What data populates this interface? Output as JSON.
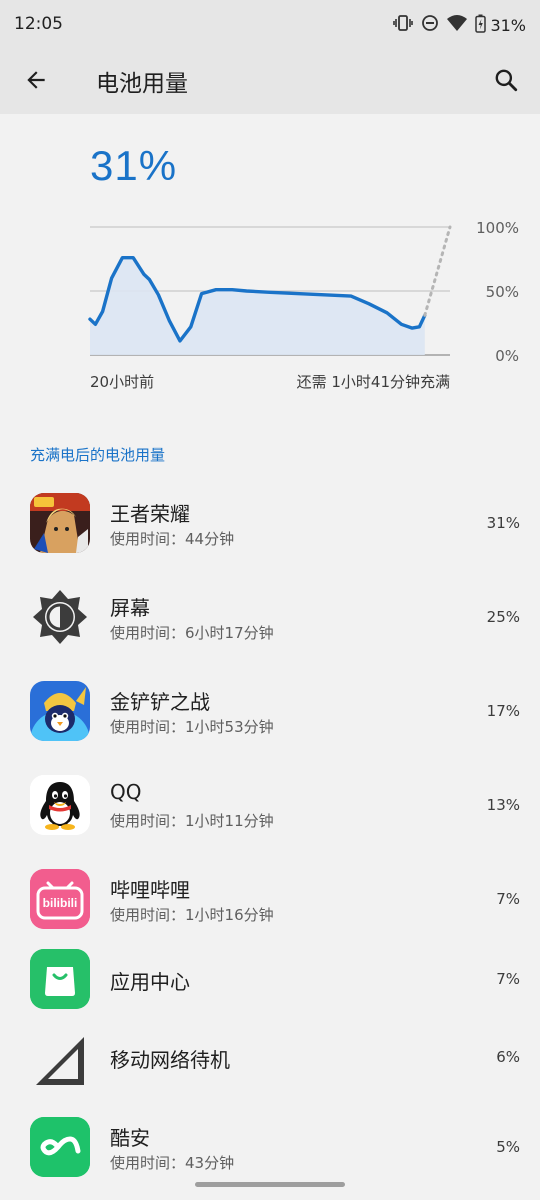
{
  "status_bar": {
    "time": "12:05",
    "battery_percent": "31%",
    "icons": [
      "vibrate-icon",
      "do-not-disturb-icon",
      "wifi-icon",
      "battery-charging-icon"
    ]
  },
  "app_bar": {
    "title": "电池用量",
    "back_icon": "arrow-back-icon",
    "search_icon": "search-icon"
  },
  "battery_level": "31%",
  "chart_data": {
    "type": "area",
    "title": "",
    "y_tick_labels": [
      "100%",
      "50%",
      "0%"
    ],
    "ylim": [
      0,
      100
    ],
    "x_start_label": "20小时前",
    "x_end_label": "还需 1小时41分钟充满",
    "x_hours": [
      0,
      0.3,
      0.7,
      1.2,
      1.8,
      2.4,
      3.0,
      3.3,
      3.8,
      4.4,
      5.0,
      5.6,
      6.2,
      7.0,
      7.9,
      8.7,
      10.0,
      11.5,
      13.0,
      14.5,
      15.5,
      16.5,
      17.3,
      17.9,
      18.3,
      18.6
    ],
    "battery_pct": [
      28,
      24,
      34,
      60,
      76,
      76,
      63,
      59,
      47,
      27,
      11,
      22,
      48,
      51,
      51,
      50,
      49,
      48,
      47,
      46,
      40,
      33,
      24,
      21,
      22,
      31
    ],
    "projection": {
      "from_x": 18.6,
      "from_y": 31,
      "to_x": 20,
      "to_y": 100,
      "style": "dotted"
    },
    "colors": {
      "line": "#1a73c8",
      "fill": "#dce6f3",
      "projection": "#b5b5b5",
      "grid": "#bdbdbd"
    }
  },
  "section_title": "充满电后的电池用量",
  "usage_list": [
    {
      "name": "王者荣耀",
      "subtitle": "使用时间：44分钟",
      "percent": "31%",
      "icon": "honor-of-kings-app-icon"
    },
    {
      "name": "屏幕",
      "subtitle": "使用时间：6小时17分钟",
      "percent": "25%",
      "icon": "screen-brightness-icon"
    },
    {
      "name": "金铲铲之战",
      "subtitle": "使用时间：1小时53分钟",
      "percent": "17%",
      "icon": "golden-spatula-app-icon"
    },
    {
      "name": "QQ",
      "subtitle": "使用时间：1小时11分钟",
      "percent": "13%",
      "icon": "qq-penguin-app-icon"
    },
    {
      "name": "哔哩哔哩",
      "subtitle": "使用时间：1小时16分钟",
      "percent": "7%",
      "icon": "bilibili-app-icon",
      "icon_text": "bilibili"
    },
    {
      "name": "应用中心",
      "subtitle": "",
      "percent": "7%",
      "icon": "app-center-bag-icon"
    },
    {
      "name": "移动网络待机",
      "subtitle": "",
      "percent": "6%",
      "icon": "cell-signal-icon"
    },
    {
      "name": "酷安",
      "subtitle": "使用时间：43分钟",
      "percent": "5%",
      "icon": "coolapk-app-icon"
    }
  ]
}
